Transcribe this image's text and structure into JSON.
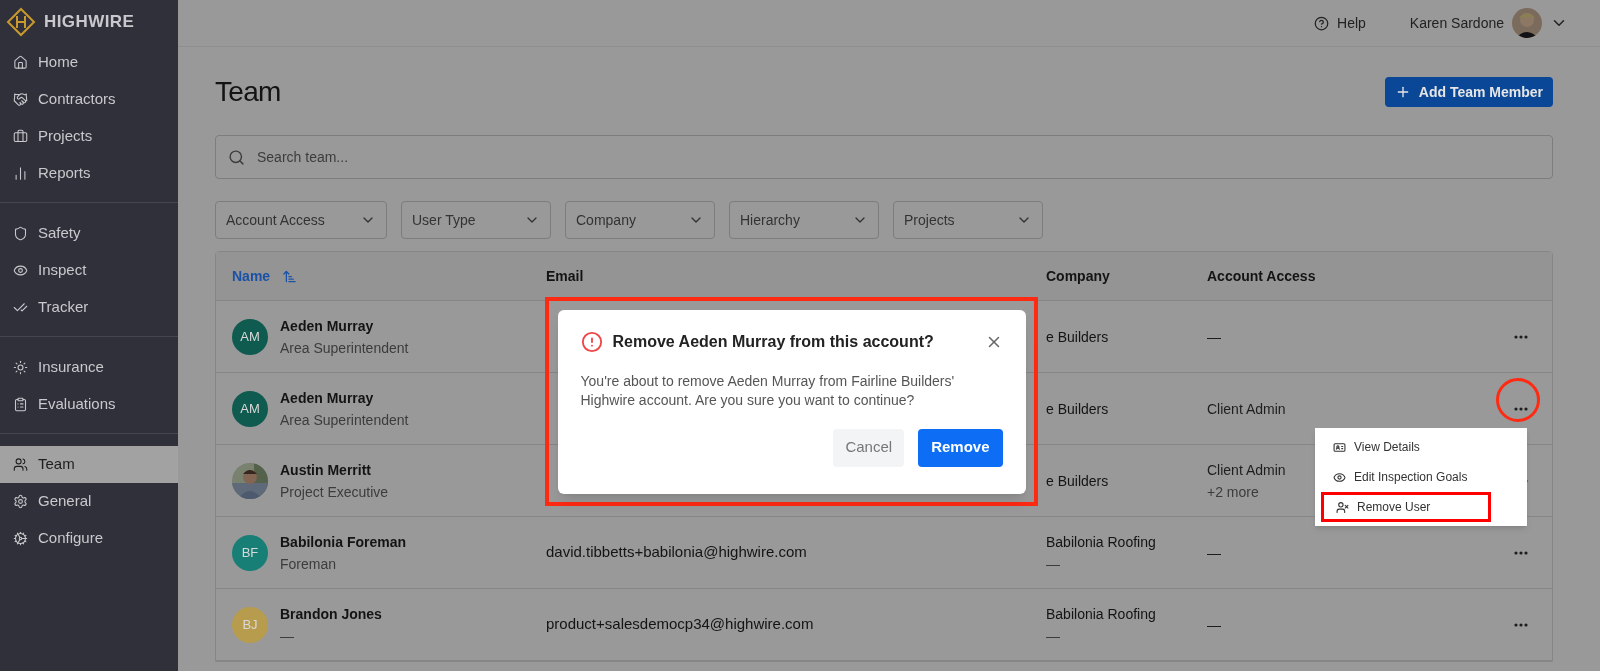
{
  "brand": "HIGHWIRE",
  "sidebar": {
    "groups": [
      {
        "items": [
          {
            "label": "Home",
            "selected": false
          },
          {
            "label": "Contractors",
            "selected": false
          },
          {
            "label": "Projects",
            "selected": false
          },
          {
            "label": "Reports",
            "selected": false
          }
        ]
      },
      {
        "items": [
          {
            "label": "Safety",
            "selected": false
          },
          {
            "label": "Inspect",
            "selected": false
          },
          {
            "label": "Tracker",
            "selected": false
          }
        ]
      },
      {
        "items": [
          {
            "label": "Insurance",
            "selected": false
          },
          {
            "label": "Evaluations",
            "selected": false
          }
        ]
      },
      {
        "items": [
          {
            "label": "Team",
            "selected": true
          },
          {
            "label": "General",
            "selected": false
          },
          {
            "label": "Configure",
            "selected": false
          }
        ]
      }
    ]
  },
  "top_bar": {
    "help": "Help",
    "user_name": "Karen Sardone"
  },
  "page_title": "Team",
  "add_button": "Add Team Member",
  "search": {
    "placeholder": "Search team..."
  },
  "filters": [
    "Account Access",
    "User Type",
    "Company",
    "Hierarchy",
    "Projects"
  ],
  "table": {
    "columns": [
      {
        "label": "Name",
        "sorted": true
      },
      {
        "label": "Email",
        "sorted": false
      },
      {
        "label": "Company",
        "sorted": false
      },
      {
        "label": "Account Access",
        "sorted": false
      }
    ],
    "rows": [
      {
        "kind": "initials",
        "initials": "AM",
        "color": "#0f5b4f",
        "name": "Aeden Murray",
        "role": "Area Superintendent",
        "company": "e Builders",
        "access": "—"
      },
      {
        "kind": "initials",
        "initials": "AM",
        "color": "#0f5b4f",
        "name": "Aeden Murray",
        "role": "Area Superintendent",
        "company": "e Builders",
        "access": "Client Admin"
      },
      {
        "name": "Austin Merritt",
        "role": "Project Executive",
        "company": "e Builders",
        "access": "Client Admin",
        "access_more": "+2 more"
      },
      {
        "kind": "initials",
        "initials": "BF",
        "color": "#177f75",
        "name": "Babilonia Foreman",
        "role": "Foreman",
        "email": "david.tibbetts+babilonia@highwire.com",
        "company": "Babilonia Roofing",
        "company_sub": "—",
        "access": "—"
      },
      {
        "kind": "initials",
        "initials": "BJ",
        "color": "#b89c4e",
        "name": "Brandon Jones",
        "role": "—",
        "email": "product+salesdemocp34@highwire.com",
        "company": "Babilonia Roofing",
        "company_sub": "—",
        "access": "—"
      }
    ]
  },
  "row_menu": {
    "items": [
      {
        "label": "View Details",
        "highlighted": false
      },
      {
        "label": "Edit Inspection Goals",
        "highlighted": false
      },
      {
        "label": "Remove User",
        "highlighted": true
      }
    ]
  },
  "dialog": {
    "title": "Remove Aeden Murray from this account?",
    "message": "You're about to remove Aeden Murray from Fairline Builders' Highwire account. Are you sure you want to continue?",
    "cancel": "Cancel",
    "confirm": "Remove",
    "highlighted": true
  }
}
